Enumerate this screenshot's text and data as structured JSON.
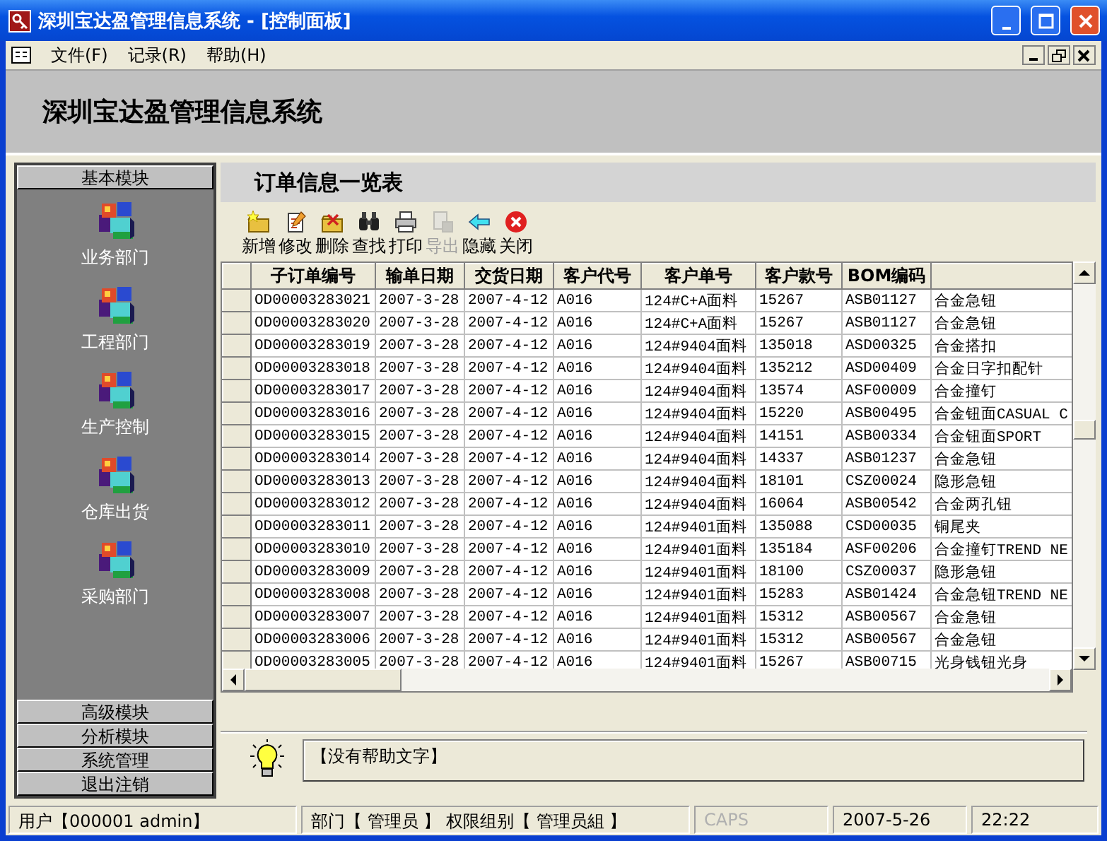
{
  "window": {
    "title": "深圳宝达盈管理信息系统 - [控制面板]"
  },
  "menu": [
    {
      "label": "文件(F)"
    },
    {
      "label": "记录(R)"
    },
    {
      "label": "帮助(H)"
    }
  ],
  "header": {
    "title": "深圳宝达盈管理信息系统"
  },
  "sidebar": [
    {
      "label": "基本模块",
      "expanded": true,
      "items": [
        "业务部门",
        "工程部门",
        "生产控制",
        "仓库出货",
        "采购部门"
      ]
    },
    {
      "label": "高级模块",
      "expanded": false
    },
    {
      "label": "分析模块",
      "expanded": false
    },
    {
      "label": "系统管理",
      "expanded": false
    },
    {
      "label": "退出注销",
      "expanded": false
    }
  ],
  "panel": {
    "title": "订单信息一览表"
  },
  "toolbar": [
    {
      "kind": "new",
      "label": "新增",
      "disabled": false
    },
    {
      "kind": "edit",
      "label": "修改",
      "disabled": false
    },
    {
      "kind": "delete",
      "label": "删除",
      "disabled": false
    },
    {
      "kind": "find",
      "label": "查找",
      "disabled": false
    },
    {
      "kind": "print",
      "label": "打印",
      "disabled": false
    },
    {
      "kind": "export",
      "label": "导出",
      "disabled": true
    },
    {
      "kind": "hide",
      "label": "隐藏",
      "disabled": false
    },
    {
      "kind": "close",
      "label": "关闭",
      "disabled": false
    }
  ],
  "table": {
    "columns": [
      "子订单编号",
      "输单日期",
      "交货日期",
      "客户代号",
      "客户单号",
      "客户款号",
      "BOM编码"
    ],
    "rows": [
      [
        "OD00003283021",
        "2007-3-28",
        "2007-4-12",
        "A016",
        "124#C+A面料",
        "15267",
        "ASB01127",
        "合金急钮"
      ],
      [
        "OD00003283020",
        "2007-3-28",
        "2007-4-12",
        "A016",
        "124#C+A面料",
        "15267",
        "ASB01127",
        "合金急钮"
      ],
      [
        "OD00003283019",
        "2007-3-28",
        "2007-4-12",
        "A016",
        "124#9404面料",
        "135018",
        "ASD00325",
        "合金搭扣"
      ],
      [
        "OD00003283018",
        "2007-3-28",
        "2007-4-12",
        "A016",
        "124#9404面料",
        "135212",
        "ASD00409",
        "合金日字扣配针"
      ],
      [
        "OD00003283017",
        "2007-3-28",
        "2007-4-12",
        "A016",
        "124#9404面料",
        "13574",
        "ASF00009",
        "合金撞钉"
      ],
      [
        "OD00003283016",
        "2007-3-28",
        "2007-4-12",
        "A016",
        "124#9404面料",
        "15220",
        "ASB00495",
        "合金钮面CASUAL C"
      ],
      [
        "OD00003283015",
        "2007-3-28",
        "2007-4-12",
        "A016",
        "124#9404面料",
        "14151",
        "ASB00334",
        "合金钮面SPORT"
      ],
      [
        "OD00003283014",
        "2007-3-28",
        "2007-4-12",
        "A016",
        "124#9404面料",
        "14337",
        "ASB01237",
        "合金急钮"
      ],
      [
        "OD00003283013",
        "2007-3-28",
        "2007-4-12",
        "A016",
        "124#9404面料",
        "18101",
        "CSZ00024",
        "隐形急钮"
      ],
      [
        "OD00003283012",
        "2007-3-28",
        "2007-4-12",
        "A016",
        "124#9404面料",
        "16064",
        "ASB00542",
        "合金两孔钮"
      ],
      [
        "OD00003283011",
        "2007-3-28",
        "2007-4-12",
        "A016",
        "124#9401面料",
        "135088",
        "CSD00035",
        "铜尾夹"
      ],
      [
        "OD00003283010",
        "2007-3-28",
        "2007-4-12",
        "A016",
        "124#9401面料",
        "135184",
        "ASF00206",
        "合金撞钉TREND NE"
      ],
      [
        "OD00003283009",
        "2007-3-28",
        "2007-4-12",
        "A016",
        "124#9401面料",
        "18100",
        "CSZ00037",
        "隐形急钮"
      ],
      [
        "OD00003283008",
        "2007-3-28",
        "2007-4-12",
        "A016",
        "124#9401面料",
        "15283",
        "ASB01424",
        "合金急钮TREND NE"
      ],
      [
        "OD00003283007",
        "2007-3-28",
        "2007-4-12",
        "A016",
        "124#9401面料",
        "15312",
        "ASB00567",
        "合金急钮"
      ],
      [
        "OD00003283006",
        "2007-3-28",
        "2007-4-12",
        "A016",
        "124#9401面料",
        "15312",
        "ASB00567",
        "合金急钮"
      ],
      [
        "OD00003283005",
        "2007-3-28",
        "2007-4-12",
        "A016",
        "124#9401面料",
        "15267",
        "ASB00715",
        "光身钱钮光身"
      ]
    ]
  },
  "help": {
    "text": "【没有帮助文字】"
  },
  "status_bar": [
    {
      "text": "用户【000001 admin】",
      "disabled": false
    },
    {
      "text": "部门【 管理员 】 权限组别【 管理员組 】",
      "disabled": false
    },
    {
      "text": "CAPS",
      "disabled": true
    },
    {
      "text": "2007-5-26",
      "disabled": false
    },
    {
      "text": "22:22",
      "disabled": false
    }
  ]
}
